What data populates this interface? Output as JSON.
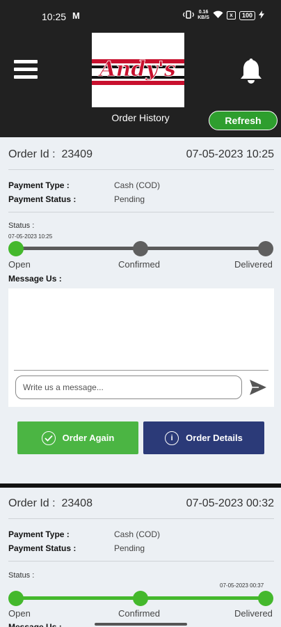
{
  "statusbar": {
    "time": "10:25",
    "m_icon": "M",
    "battery": "100",
    "mini_net": "0.16\nKB/S"
  },
  "header": {
    "title": "Order History",
    "refresh_label": "Refresh",
    "logo_text": "Andy's"
  },
  "labels": {
    "order_id": "Order Id :",
    "payment_type": "Payment Type :",
    "payment_status": "Payment Status :",
    "status": "Status :",
    "message_us": "Message Us :",
    "message_placeholder": "Write us a message...",
    "order_again": "Order Again",
    "order_details": "Order Details",
    "info_glyph": "i"
  },
  "orders": [
    {
      "order_id": "23409",
      "datetime": "07-05-2023 10:25",
      "payment_type": "Cash (COD)",
      "payment_status": "Pending",
      "status_date": "07-05-2023 10:25",
      "steps": [
        "Open",
        "Confirmed",
        "Delivered"
      ],
      "progress_step": 0
    },
    {
      "order_id": "23408",
      "datetime": "07-05-2023 00:32",
      "payment_type": "Cash (COD)",
      "payment_status": "Pending",
      "status_date": "07-05-2023 00:37",
      "steps": [
        "Open",
        "Confirmed",
        "Delivered"
      ],
      "progress_step": 2
    }
  ],
  "colors": {
    "header_bg": "#212121",
    "green": "#4bb543",
    "navy": "#2b3a78",
    "track": "#5a5a5a"
  }
}
